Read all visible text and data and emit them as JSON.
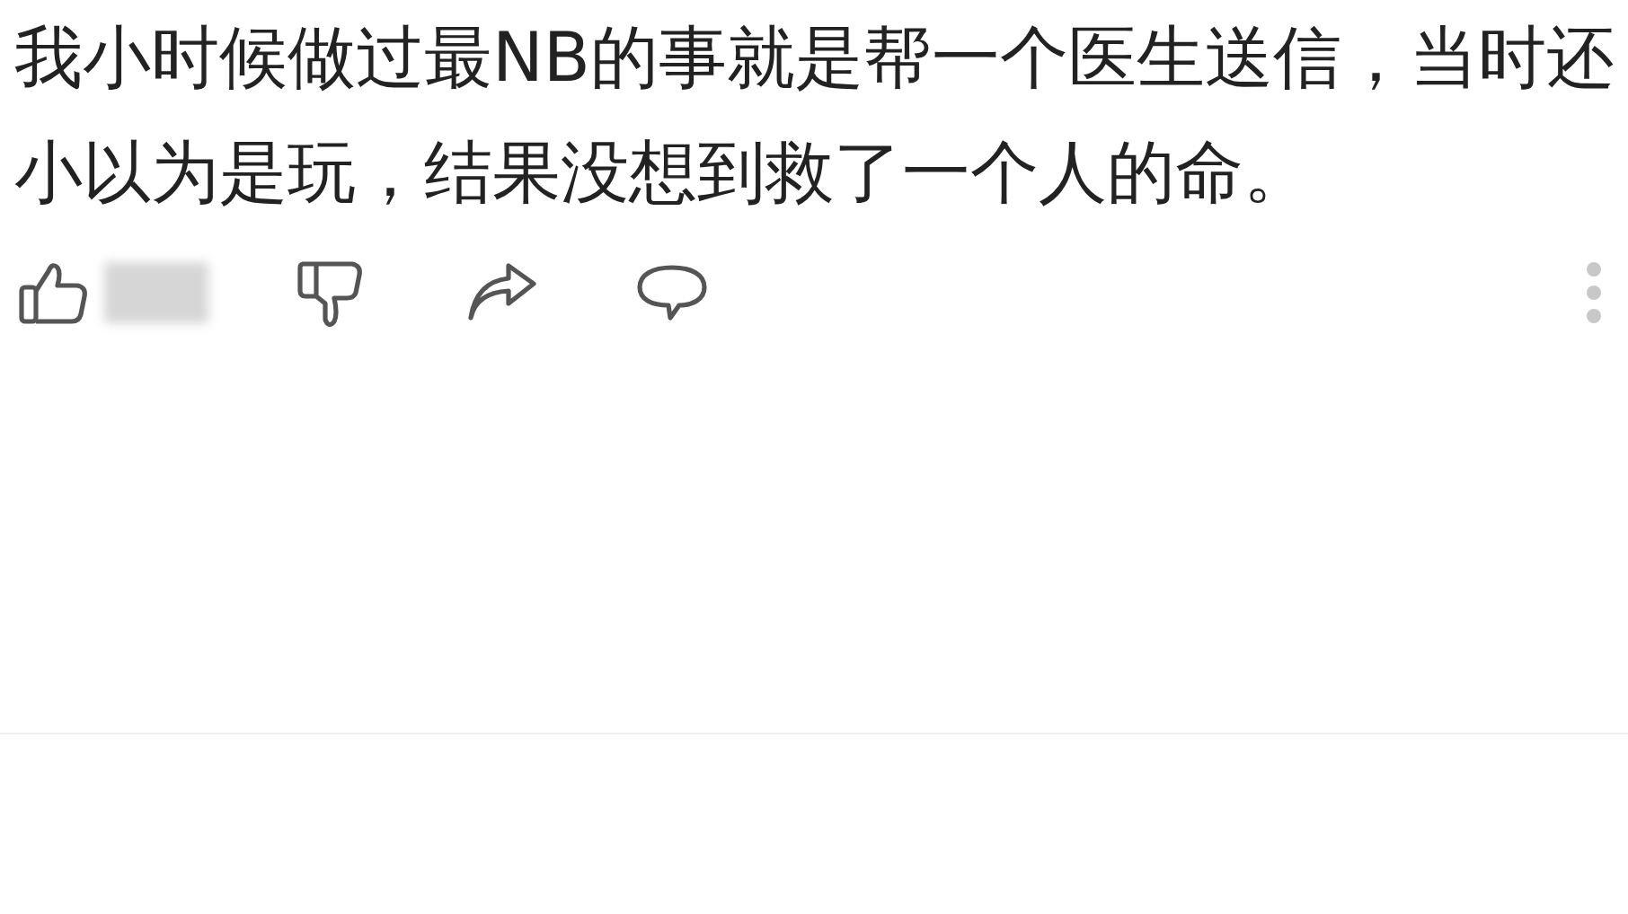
{
  "comment": {
    "text": "我小时候做过最NB的事就是帮一个医生送信，当时还小以为是玩，结果没想到救了一个人的命。"
  }
}
